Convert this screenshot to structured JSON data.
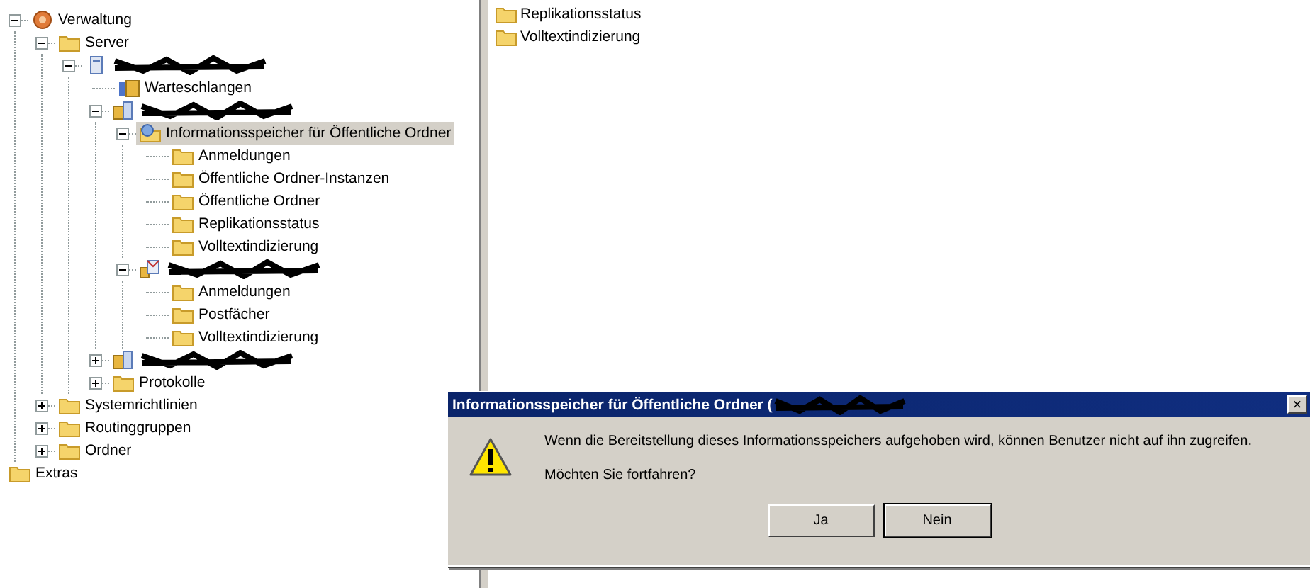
{
  "tree": [
    {
      "kind": "org",
      "label": "Verwaltung",
      "expanded": true,
      "selected": false,
      "children": [
        {
          "kind": "folder",
          "label": "Server",
          "expanded": true,
          "selected": false,
          "children": [
            {
              "kind": "server",
              "redacted": true,
              "expanded": true,
              "selected": false,
              "children": [
                {
                  "kind": "queue",
                  "label": "Warteschlangen",
                  "selected": false
                },
                {
                  "kind": "storage",
                  "redacted": true,
                  "expanded": true,
                  "selected": false,
                  "children": [
                    {
                      "kind": "public-store",
                      "label": "Informationsspeicher für Öffentliche Ordner",
                      "expanded": true,
                      "selected": true,
                      "children": [
                        {
                          "kind": "folder",
                          "label": "Anmeldungen",
                          "selected": false
                        },
                        {
                          "kind": "folder",
                          "label": "Öffentliche Ordner-Instanzen",
                          "selected": false
                        },
                        {
                          "kind": "folder",
                          "label": "Öffentliche Ordner",
                          "selected": false
                        },
                        {
                          "kind": "folder",
                          "label": "Replikationsstatus",
                          "selected": false
                        },
                        {
                          "kind": "folder",
                          "label": "Volltextindizierung",
                          "selected": false
                        }
                      ]
                    },
                    {
                      "kind": "mailbox-store",
                      "redacted": true,
                      "expanded": true,
                      "selected": false,
                      "children": [
                        {
                          "kind": "folder",
                          "label": "Anmeldungen",
                          "selected": false
                        },
                        {
                          "kind": "folder",
                          "label": "Postfächer",
                          "selected": false
                        },
                        {
                          "kind": "folder",
                          "label": "Volltextindizierung",
                          "selected": false
                        }
                      ]
                    }
                  ]
                },
                {
                  "kind": "storage",
                  "redacted": true,
                  "expanded": false,
                  "selected": false
                },
                {
                  "kind": "folder",
                  "label": "Protokolle",
                  "expanded": false,
                  "selected": false
                }
              ]
            }
          ]
        },
        {
          "kind": "folder",
          "label": "Systemrichtlinien",
          "expanded": false,
          "selected": false
        },
        {
          "kind": "folder",
          "label": "Routinggruppen",
          "expanded": false,
          "selected": false
        },
        {
          "kind": "folder",
          "label": "Ordner",
          "expanded": false,
          "selected": false
        }
      ]
    },
    {
      "kind": "folder",
      "label": "Extras",
      "selected": false
    }
  ],
  "details": [
    {
      "label": "Replikationsstatus"
    },
    {
      "label": "Volltextindizierung"
    }
  ],
  "dialog": {
    "title": "Informationsspeicher für Öffentliche Ordner (",
    "title_redacted": true,
    "close": "×",
    "message": "Wenn die Bereitstellung dieses Informationsspeichers aufgehoben wird, können Benutzer nicht auf ihn zugreifen.",
    "question": "Möchten Sie fortfahren?",
    "buttons": [
      {
        "label": "Ja",
        "default": false
      },
      {
        "label": "Nein",
        "default": true
      }
    ]
  }
}
